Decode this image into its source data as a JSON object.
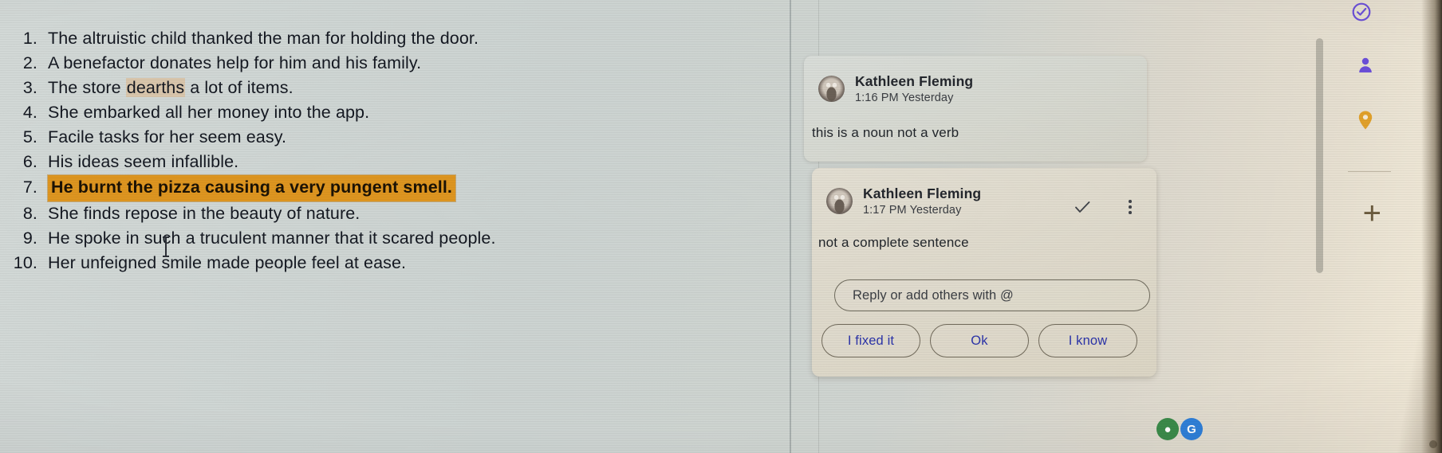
{
  "document": {
    "items": [
      {
        "number": "1.",
        "text": "The altruistic child thanked the man for holding the door.",
        "highlight": "none"
      },
      {
        "number": "2.",
        "text": "A benefactor donates help for him and his family.",
        "highlight": "none"
      },
      {
        "number": "3.",
        "text": "The store dearths a lot of items.",
        "highlight": "word",
        "highlight_word": "dearths"
      },
      {
        "number": "4.",
        "text": "She embarked all her money into the app.",
        "highlight": "none"
      },
      {
        "number": "5.",
        "text": "Facile tasks for her seem easy.",
        "highlight": "none"
      },
      {
        "number": "6.",
        "text": "His ideas seem infallible.",
        "highlight": "none"
      },
      {
        "number": "7.",
        "text": "He burnt the pizza causing a very pungent smell.",
        "highlight": "full"
      },
      {
        "number": "8.",
        "text": "She finds repose in the beauty of nature.",
        "highlight": "none"
      },
      {
        "number": "9.",
        "text": "He spoke in such a truculent manner that it scared people.",
        "highlight": "none"
      },
      {
        "number": "10.",
        "text": "Her unfeigned smile made people feel at ease.",
        "highlight": "none"
      }
    ]
  },
  "comments": {
    "card_one": {
      "author": "Kathleen Fleming",
      "timestamp": "1:16 PM Yesterday",
      "body": "this is a noun not a verb"
    },
    "card_two": {
      "author": "Kathleen Fleming",
      "timestamp": "1:17 PM Yesterday",
      "body": "not a complete sentence",
      "reply_placeholder": "Reply or add others with @",
      "chips": [
        {
          "label": "I fixed it"
        },
        {
          "label": "Ok"
        },
        {
          "label": "I know"
        }
      ]
    }
  },
  "rail": {
    "add_label": "+",
    "icons": [
      "tasks-check-icon",
      "contacts-person-icon",
      "maps-pin-icon"
    ]
  },
  "fabs": {
    "mic_label": "●",
    "google_label": "G"
  },
  "colors": {
    "highlight_full": "#dd9520",
    "highlight_word": "#d8c5ab",
    "chip_text": "#2b33a8",
    "rail_purple": "#6b4fd8",
    "rail_amber": "#e0a02a"
  }
}
